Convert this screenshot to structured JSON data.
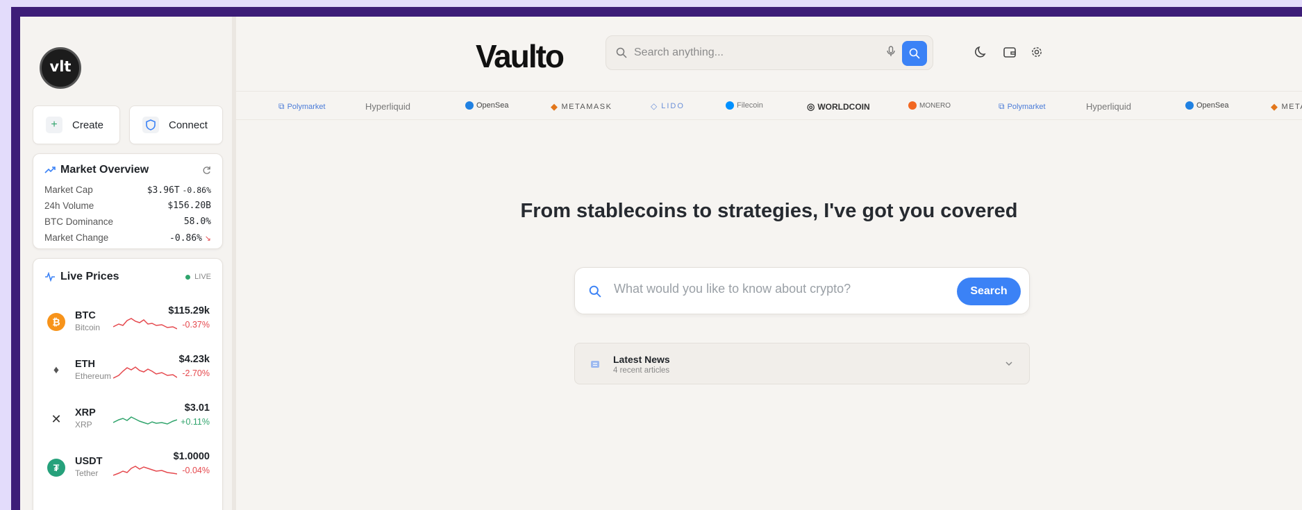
{
  "app": {
    "brand": "Vaulto",
    "logo_text": "vlt"
  },
  "sidebar": {
    "create_label": "Create",
    "connect_label": "Connect",
    "market": {
      "title": "Market Overview",
      "rows": [
        {
          "label": "Market Cap",
          "value": "$3.96T",
          "change": "-0.86%"
        },
        {
          "label": "24h Volume",
          "value": "$156.20B"
        },
        {
          "label": "BTC Dominance",
          "value": "58.0%"
        },
        {
          "label": "Market Change",
          "value": "-0.86%"
        }
      ]
    },
    "live": {
      "title": "Live Prices",
      "badge": "LIVE",
      "coins": [
        {
          "symbol": "BTC",
          "name": "Bitcoin",
          "price": "$115.29k",
          "change": "-0.37%",
          "trend": "down"
        },
        {
          "symbol": "ETH",
          "name": "Ethereum",
          "price": "$4.23k",
          "change": "-2.70%",
          "trend": "down"
        },
        {
          "symbol": "XRP",
          "name": "XRP",
          "price": "$3.01",
          "change": "+0.11%",
          "trend": "up"
        },
        {
          "symbol": "USDT",
          "name": "Tether",
          "price": "$1.0000",
          "change": "-0.04%",
          "trend": "down"
        }
      ]
    }
  },
  "header": {
    "search_placeholder": "Search anything..."
  },
  "partners": [
    "Polymarket",
    "Hyperliquid",
    "OpenSea",
    "METAMASK",
    "LIDO",
    "Filecoin",
    "WORLDCOIN",
    "MONERO",
    "Polymarket",
    "Hyperliquid",
    "OpenSea",
    "METAMASK"
  ],
  "main": {
    "headline": "From stablecoins to strategies, I've got you covered",
    "ask_placeholder": "What would you like to know about crypto?",
    "search_button": "Search",
    "news": {
      "title": "Latest News",
      "subtitle": "4 recent articles"
    }
  },
  "colors": {
    "accent": "#3b82f6",
    "negative": "#e5484d",
    "positive": "#30a46c",
    "frame": "#3d1d78",
    "outer": "#e3dcfb"
  }
}
